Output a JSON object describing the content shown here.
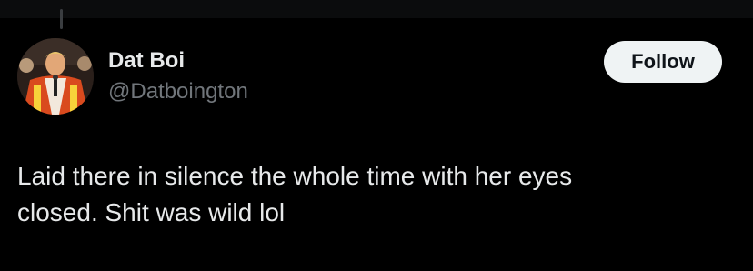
{
  "tweet": {
    "author": {
      "display_name": "Dat Boi",
      "handle": "@Datboington"
    },
    "follow_label": "Follow",
    "text_line_1": "Laid there in silence the whole time with her eyes",
    "text_line_2": "closed. Shit was wild lol"
  },
  "colors": {
    "background": "#000000",
    "primary_text": "#e7e9ea",
    "secondary_text": "#71767b",
    "follow_button_bg": "#eff3f4",
    "follow_button_text": "#0f1419"
  }
}
